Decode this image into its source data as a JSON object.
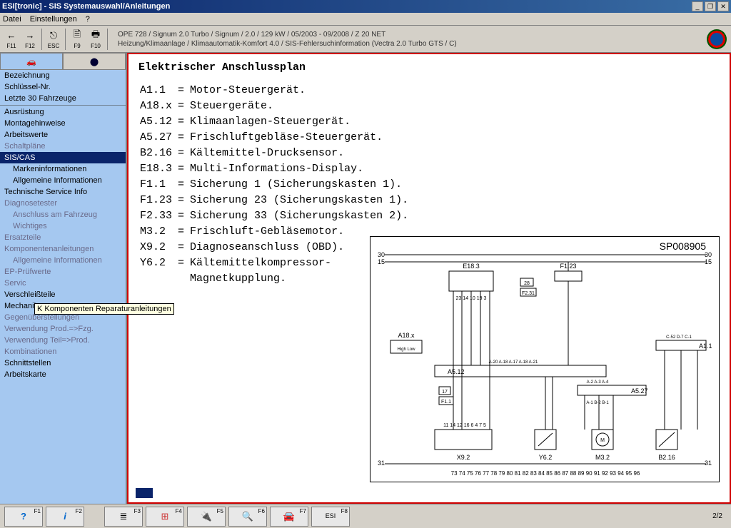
{
  "window": {
    "title": "ESI[tronic] - SIS Systemauswahl/Anleitungen"
  },
  "menu": {
    "datei": "Datei",
    "einstellungen": "Einstellungen",
    "help": "?"
  },
  "toolbar": {
    "f11": "F11",
    "f12": "F12",
    "esc": "ESC",
    "f9": "F9",
    "f10": "F10",
    "back_icon": "←",
    "fwd_icon": "→",
    "esc_icon": "⎋",
    "f9_icon": "🗎",
    "f10_icon": "🖶"
  },
  "breadcrumb": {
    "line1": "OPE 728 / Signum 2.0 Turbo / Signum / 2.0 / 129 kW / 05/2003 - 09/2008 / Z 20 NET",
    "line2": "Heizung/Klimaanlage / Klimaautomatik-Komfort 4.0 / SIS-Fehlersuchinformation  (Vectra 2.0 Turbo GTS  /  C)"
  },
  "sidebar_top": {
    "bezeichnung": "Bezeichnung",
    "schluessel": "Schlüssel-Nr.",
    "letzte30": "Letzte 30 Fahrzeuge"
  },
  "sidebar": {
    "ausruestung": "Ausrüstung",
    "montagehinweise": "Montagehinweise",
    "arbeitswerte": "Arbeitswerte",
    "schaltplaene": "Schaltpläne",
    "siscas": "SIS/CAS",
    "markeninfo": "Markeninformationen",
    "allginfo": "Allgemeine Informationen",
    "techservice": "Technische Service Info",
    "diagtester": "Diagnosetester",
    "anschluss": "Anschluss am Fahrzeug",
    "wichtiges": "Wichtiges",
    "ersatzteile": "Ersatzteile",
    "kompanleitungen": "Komponentenanleitungen",
    "allginfo2": "Allgemeine Informationen",
    "eppruef": "EP-Prüfwerte",
    "service": "Servic",
    "verschleiss": "Verschleißteile",
    "mechanik": "Mechanik",
    "gegenueber": "Gegenüberstellungen",
    "verwprod": "Verwendung Prod.=>Fzg.",
    "verwteil": "Verwendung Teil=>Prod.",
    "kombinationen": "Kombinationen",
    "schnittstellen": "Schnittstellen",
    "arbeitskarte": "Arbeitskarte"
  },
  "tooltip": "K Komponenten Reparaturanleitungen",
  "doc": {
    "title": "Elektrischer Anschlussplan",
    "components": [
      {
        "id": "A1.1",
        "eq": "=",
        "desc": "Motor-Steuergerät."
      },
      {
        "id": "A18.x",
        "eq": "=",
        "desc": "Steuergeräte."
      },
      {
        "id": "A5.12",
        "eq": "=",
        "desc": "Klimaanlagen-Steuergerät."
      },
      {
        "id": "A5.27",
        "eq": "=",
        "desc": "Frischluftgebläse-Steuergerät."
      },
      {
        "id": "B2.16",
        "eq": "=",
        "desc": "Kältemittel-Drucksensor."
      },
      {
        "id": "E18.3",
        "eq": "=",
        "desc": "Multi-Informations-Display."
      },
      {
        "id": "F1.1",
        "eq": "=",
        "desc": "Sicherung 1 (Sicherungskasten 1)."
      },
      {
        "id": "F1.23",
        "eq": "=",
        "desc": "Sicherung 23 (Sicherungskasten 1)."
      },
      {
        "id": "F2.33",
        "eq": "=",
        "desc": "Sicherung 33 (Sicherungskasten 2)."
      },
      {
        "id": "M3.2",
        "eq": "=",
        "desc": "Frischluft-Gebläsemotor."
      },
      {
        "id": "X9.2",
        "eq": "=",
        "desc": "Diagnoseanschluss (OBD)."
      },
      {
        "id": "Y6.2",
        "eq": "=",
        "desc": "Kältemittelkompressor-"
      },
      {
        "id": "",
        "eq": "",
        "desc": "Magnetkupplung."
      }
    ],
    "schematic_id": "SP008905",
    "schematic_labels": {
      "e183": "E18.3",
      "f123": "F1.23",
      "a11": "A1.1",
      "a18x": "A18.x",
      "highlow": "High Low",
      "a512": "A5.12",
      "a527": "A5.27",
      "f11": "F1.1",
      "seventeen": "17",
      "f231": "F2.31",
      "t28": "28",
      "x92": "X9.2",
      "y62": "Y6.2",
      "m32": "M3.2",
      "b216": "B2.16",
      "c52": "C-52 D-7 C-1",
      "a20row": "A-20 A-18 A-17 A-18 A-21",
      "abrow": "A-2  A-3  A-4",
      "brow": "A-1  B-2  B-1",
      "rail30": "30",
      "rail15": "15",
      "rail31": "31",
      "pins_left": "23   14   10   19    3",
      "pins_mid": "11   14   12   16     6   4    7   5",
      "bottom_nums": "73 74 75 76 77 78 79 80 81 82 83 84 85 86 87 88 89 90 91 92 93 94 95 96"
    }
  },
  "bottom": {
    "f1": "F1",
    "f2": "F2",
    "f3": "F3",
    "f4": "F4",
    "f5": "F5",
    "f6": "F6",
    "f7": "F7",
    "f8": "F8",
    "help": "?",
    "info": "i",
    "esi": "ESI",
    "page": "2/2"
  }
}
